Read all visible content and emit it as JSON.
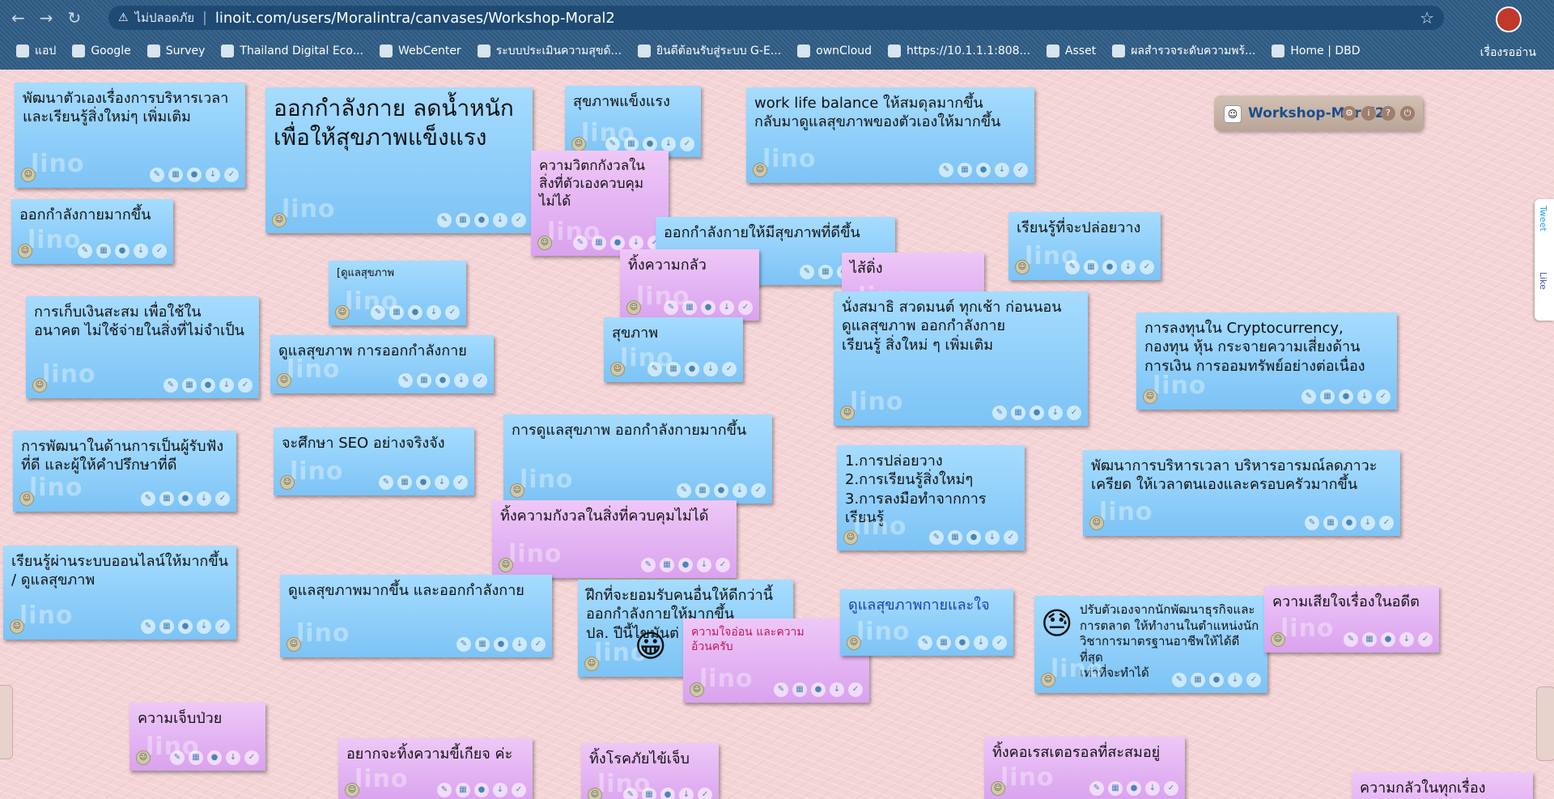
{
  "browser": {
    "insecure_label": "ไม่ปลอดภัย",
    "url": "linoit.com/users/Moralintra/canvases/Workshop-Moral2",
    "bookmarks": [
      "แอป",
      "Google",
      "Survey",
      "Thailand Digital Eco...",
      "WebCenter",
      "ระบบประเมินความสุขด้...",
      "ยินดีต้อนรับสู่ระบบ G-E...",
      "ownCloud",
      "https://10.1.1.1:808...",
      "Asset",
      "ผลสำรวจระดับความพร้...",
      "Home | DBD"
    ],
    "bookmarks_right": "เรื่องรออ่าน"
  },
  "panel": {
    "title": "Workshop-Moral2"
  },
  "social": {
    "tweet": "Tweet",
    "like": "Like"
  },
  "watermark": "lino",
  "stickies": [
    {
      "text": "พัฒนาตัวเองเรื่องการบริหารเวลา\nและเรียนรู้สิ่งใหม่ๆ เพิ่มเติม"
    },
    {
      "text": "ออกกำลังกายมากขึ้น"
    },
    {
      "text": "ออกกำลังกาย ลดน้ำหนัก\nเพื่อให้สุขภาพแข็งแรง"
    },
    {
      "text": "สุขภาพแข็งแรง"
    },
    {
      "text": "work life balance ให้สมดุลมากขึ้น\nกลับมาดูแลสุขภาพของตัวเองให้มากขึ้น"
    },
    {
      "text": "ความวิตกกังวลใน\nสิ่งที่ตัวเองควบคุม\nไม่ได้"
    },
    {
      "text": "ออกกำลังกายให้มีสุขภาพที่ดีขึ้น"
    },
    {
      "text": "เรียนรู้ที่จะปล่อยวาง"
    },
    {
      "text": "[ดูแลสุขภาพ"
    },
    {
      "text": "ทิ้งความกลัว"
    },
    {
      "text": "ไส้ติ่ง"
    },
    {
      "text": "การเก็บเงินสะสม เพื่อใช้ใน\nอนาคต ไม่ใช้จ่ายในสิ่งที่ไม่จำเป็น"
    },
    {
      "text": "นั่งสมาธิ สวดมนต์ ทุกเช้า ก่อนนอน\nดูแลสุขภาพ ออกกำลังกาย\nเรียนรู้ สิ่งใหม่ ๆ เพิ่มเติม"
    },
    {
      "text": "การลงทุนใน Cryptocurrency,\nกองทุน หุ้น กระจายความเสี่ยงด้าน\nการเงิน การออมทรัพย์อย่างต่อเนื่อง"
    },
    {
      "text": "สุขภาพ"
    },
    {
      "text": "ดูแลสุขภาพ การออกกำลังกาย"
    },
    {
      "text": "การพัฒนาในด้านการเป็นผู้รับฟัง\nที่ดี และผู้ให้คำปรึกษาที่ดี"
    },
    {
      "text": "จะศึกษา SEO อย่างจริงจัง"
    },
    {
      "text": "การดูแลสุขภาพ ออกกำลังกายมากขึ้น"
    },
    {
      "text": "1.การปล่อยวาง\n2.การเรียนรู้สิ่งใหม่ๆ\n3.การลงมือทำจากการเรียนรู้"
    },
    {
      "text": "พัฒนาการบริหารเวลา บริหารอารมณ์ลดภาวะ\nเครียด ให้เวลาตนเองและครอบครัวมากขึ้น"
    },
    {
      "text": "ทิ้งความกังวลในสิ่งที่ควบคุมไม่ได้"
    },
    {
      "text": "เรียนรู้ผ่านระบบออนไลน์ให้มากขึ้น\n/ ดูแลสุขภาพ"
    },
    {
      "text": "ดูแลสุขภาพมากขึ้น และออกกำลังกาย"
    },
    {
      "text": "ฝึกที่จะยอมรับคนอื่นให้ดีกว่านี้\nออกกำลังกายให้มากขึ้น\nปล. ปีนี้ไขมันต่"
    },
    {
      "text": "ความใจอ่อน และความ\nอ้วนครับ"
    },
    {
      "text": "ดูแลสุขภาพกายและใจ"
    },
    {
      "text": "ปรับตัวเองจากนักพัฒนาธุรกิจและ\nการตลาด ให้ทำงานในตำแหน่งนัก\nวิชาการมาตรฐานอาชีพให้ได้ดีที่สุด\nเท่าที่จะทำได้"
    },
    {
      "text": "ความเสียใจเรื่องในอดีต"
    },
    {
      "text": "ความเจ็บป่วย"
    },
    {
      "text": "อยากจะทิ้งความขี้เกียจ ค่ะ"
    },
    {
      "text": "ทิ้งโรคภัยไข้เจ็บ"
    },
    {
      "text": "ทิ้งคอเรสเตอรอลที่สะสมอยู่"
    },
    {
      "text": "ความกลัวในทุกเรื่อง"
    }
  ]
}
